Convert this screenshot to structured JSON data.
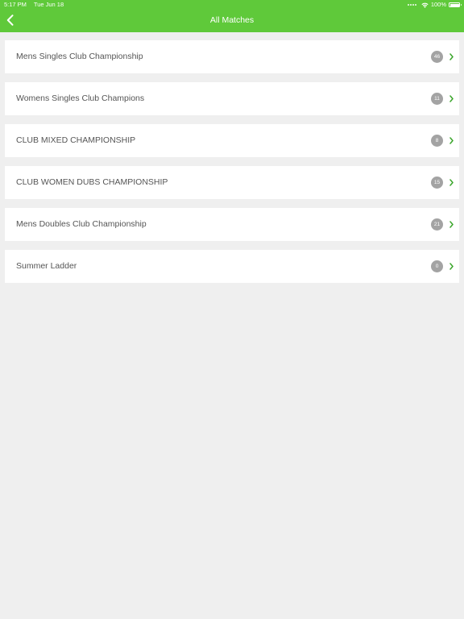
{
  "status_bar": {
    "time": "5:17 PM",
    "date": "Tue Jun 18",
    "battery": "100%"
  },
  "header": {
    "title": "All Matches",
    "back_icon": "chevron-left-icon",
    "background_color": "#5fc93a"
  },
  "matches": [
    {
      "name": "Mens Singles Club Championship",
      "count": "46"
    },
    {
      "name": "Womens Singles Club Champions",
      "count": "11"
    },
    {
      "name": "CLUB MIXED CHAMPIONSHIP",
      "count": "8"
    },
    {
      "name": "CLUB WOMEN DUBS CHAMPIONSHIP",
      "count": "15"
    },
    {
      "name": "Mens Doubles Club Championship",
      "count": "21"
    },
    {
      "name": "Summer Ladder",
      "count": "0"
    }
  ],
  "colors": {
    "accent": "#5fc93a",
    "badge": "#a3a3a3",
    "background": "#efefef",
    "chevron": "#3aa52a"
  }
}
